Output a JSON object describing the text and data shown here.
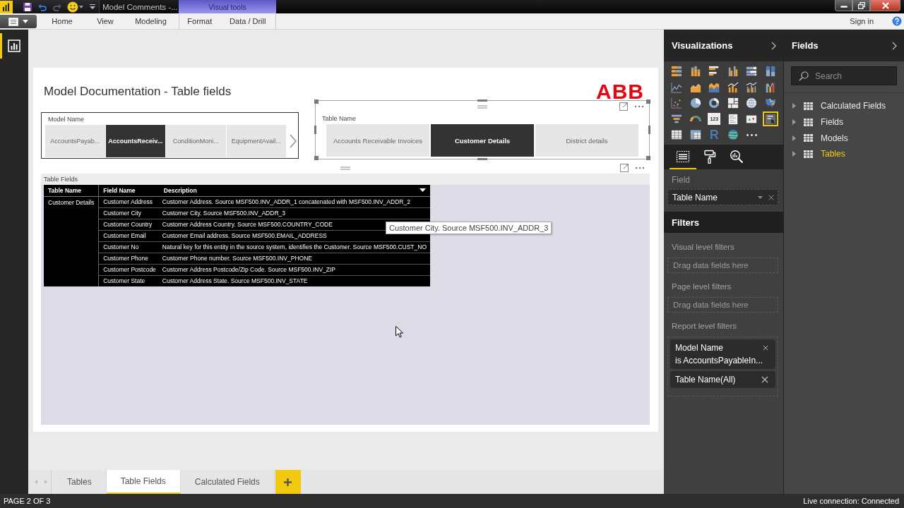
{
  "title_bar": {
    "title": "Model Comments -..."
  },
  "ribbon": {
    "tabs": [
      {
        "label": "Home",
        "selected": false
      },
      {
        "label": "View",
        "selected": false
      },
      {
        "label": "Modeling",
        "selected": false
      }
    ],
    "visual_tools": {
      "label": "Visual tools",
      "tabs": [
        {
          "label": "Format",
          "selected": false
        },
        {
          "label": "Data / Drill",
          "selected": false
        }
      ]
    },
    "sign_in": "Sign in"
  },
  "views": [
    {
      "kind": "report",
      "selected": true
    }
  ],
  "report": {
    "title": "Model Documentation - Table fields",
    "logo": "ABB",
    "slicers": [
      {
        "label": "Model Name",
        "selected": false,
        "scrollable": true,
        "items": [
          {
            "label": "AccountsPayab...",
            "selected": false
          },
          {
            "label": "AccountsReceiv...",
            "selected": true
          },
          {
            "label": "ConditionMoni...",
            "selected": false
          },
          {
            "label": "EquipmentAvail...",
            "selected": false
          }
        ]
      },
      {
        "label": "Table Name",
        "selected": true,
        "scrollable": false,
        "items": [
          {
            "label": "Accounts Receivable Invoices",
            "selected": false
          },
          {
            "label": "Customer Details",
            "selected": true
          },
          {
            "label": "District details",
            "selected": false
          }
        ]
      }
    ],
    "table_visual": {
      "title": "Table Fields",
      "columns": [
        {
          "label": "Table Name",
          "sorted": false
        },
        {
          "label": "Field Name",
          "sorted": false
        },
        {
          "label": "Description",
          "sorted": true
        }
      ],
      "groups": [
        {
          "table_name": "Customer Details",
          "rows": [
            {
              "field_name": "Customer Address",
              "description": "Customer Address. Source MSF500.INV_ADDR_1 concatenated with MSF500.INV_ADDR_2"
            },
            {
              "field_name": "Customer City",
              "description": "Customer City. Source MSF500.INV_ADDR_3"
            },
            {
              "field_name": "Customer Country",
              "description": "Customer Address Country. Source MSF500.COUNTRY_CODE"
            },
            {
              "field_name": "Customer Email",
              "description": "Customer Email address. Source MSF500.EMAIL_ADDRESS"
            },
            {
              "field_name": "Customer No",
              "description": "Natural key for this entity in the source system, identifies the Customer. Source MSF500.CUST_NO"
            },
            {
              "field_name": "Customer Phone",
              "description": "Customer Phone number. Source MSF500.INV_PHONE"
            },
            {
              "field_name": "Customer Postcode",
              "description": "Customer Address Postcode/Zip Code. Source MSF500.INV_ZIP"
            },
            {
              "field_name": "Customer State",
              "description": "Customer Address State. Source MSF500.INV_STATE"
            }
          ]
        }
      ],
      "tooltip": "Customer City. Source MSF500.INV_ADDR_3"
    }
  },
  "page_tabs": [
    {
      "label": "Tables",
      "selected": false
    },
    {
      "label": "Table Fields",
      "selected": true
    },
    {
      "label": "Calculated Fields",
      "selected": false
    }
  ],
  "visualizations": {
    "title": "Visualizations",
    "visuals": [
      {
        "kind": "stacked-bar-chart",
        "selected": false
      },
      {
        "kind": "stacked-column-chart",
        "selected": false
      },
      {
        "kind": "clustered-bar-chart",
        "selected": false
      },
      {
        "kind": "clustered-column-chart",
        "selected": false
      },
      {
        "kind": "full-bar-chart",
        "selected": false
      },
      {
        "kind": "full-column-chart",
        "selected": false
      },
      {
        "kind": "line-chart",
        "selected": false
      },
      {
        "kind": "area-chart",
        "selected": false
      },
      {
        "kind": "stacked-area-chart",
        "selected": false
      },
      {
        "kind": "line-and-column-chart",
        "selected": false
      },
      {
        "kind": "line-and-clustered-column-chart",
        "selected": false
      },
      {
        "kind": "ribbon-chart",
        "selected": false
      },
      {
        "kind": "scatter-chart",
        "selected": false
      },
      {
        "kind": "pie-chart",
        "selected": false
      },
      {
        "kind": "donut-chart",
        "selected": false
      },
      {
        "kind": "treemap",
        "selected": false
      },
      {
        "kind": "globe",
        "selected": false
      },
      {
        "kind": "filled-map",
        "selected": false
      },
      {
        "kind": "funnel",
        "selected": false
      },
      {
        "kind": "gauge",
        "selected": false
      },
      {
        "kind": "card",
        "label": "123",
        "selected": false
      },
      {
        "kind": "multi-row-card",
        "selected": false
      },
      {
        "kind": "kpi",
        "selected": false
      },
      {
        "kind": "slicer",
        "selected": true
      },
      {
        "kind": "table",
        "selected": false
      },
      {
        "kind": "matrix",
        "selected": false
      },
      {
        "kind": "r-script",
        "label": "R",
        "selected": false
      },
      {
        "kind": "world-globe",
        "selected": false
      },
      {
        "kind": "more",
        "selected": false
      }
    ],
    "pane_tabs": [
      {
        "kind": "fields",
        "selected": true
      },
      {
        "kind": "format",
        "selected": false
      },
      {
        "kind": "analytics",
        "selected": false
      }
    ],
    "well_label": "Field",
    "well_value": "Table Name"
  },
  "filters": {
    "title": "Filters",
    "sections": [
      {
        "label": "Visual level filters",
        "placeholder": "Drag data fields here"
      },
      {
        "label": "Page level filters",
        "placeholder": "Drag data fields here"
      },
      {
        "label": "Report level filters",
        "cards": [
          {
            "name": "Model Name",
            "condition": "is AccountsPayableIn..."
          },
          {
            "name": "Table Name(All)"
          }
        ]
      }
    ]
  },
  "fields_pane": {
    "title": "Fields",
    "search_placeholder": "Search",
    "tables": [
      {
        "name": "Calculated Fields",
        "selected": false
      },
      {
        "name": "Fields",
        "selected": false
      },
      {
        "name": "Models",
        "selected": false
      },
      {
        "name": "Tables",
        "selected": true
      }
    ]
  },
  "status_bar": {
    "page": "PAGE 2 OF 3",
    "connection": "Live connection: Connected"
  }
}
